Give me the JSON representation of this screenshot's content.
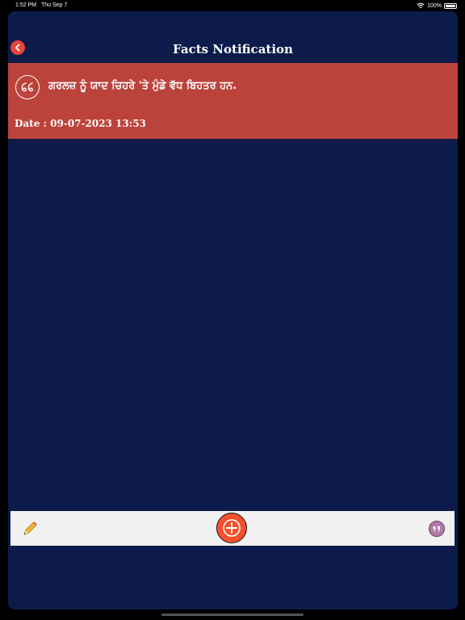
{
  "status_bar": {
    "time": "1:52 PM",
    "date": "Thu Sep 7",
    "battery": "100%",
    "icons": [
      "wifi-icon",
      "battery-icon"
    ]
  },
  "header": {
    "title": "Facts Notification",
    "back_icon": "chevron-left-icon"
  },
  "fact": {
    "text": "ਗਰਲਜ਼ ਨੂੰ ਯਾਦ ਚਿਹਰੇ 'ਤੇ ਮੁੰਡੇ ਵੱਧ ਬਿਹਤਰ ਹਨ.",
    "date_label": "Date : 09-07-2023 13:53",
    "icon": "quote-icon"
  },
  "toolbar": {
    "edit_icon": "pencil-icon",
    "add_icon": "plus-icon",
    "quote_icon": "quote-icon"
  },
  "colors": {
    "background": "#0c1b49",
    "card": "#bc433b",
    "toolbar": "#f1f1f1",
    "accent": "#f4512c",
    "back_button": "#e8453c",
    "quote_button": "#b27aa7"
  }
}
